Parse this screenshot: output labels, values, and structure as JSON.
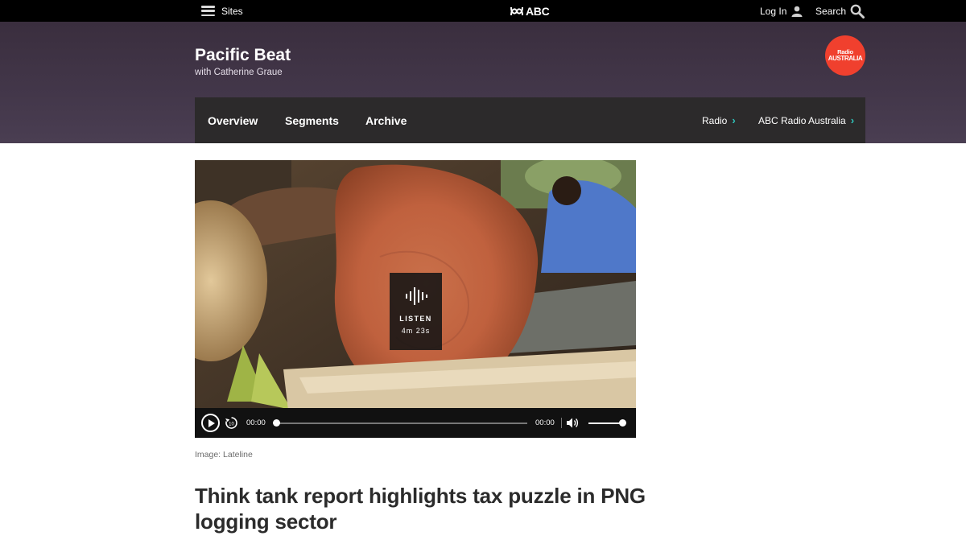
{
  "topbar": {
    "sites_label": "Sites",
    "logo_text": "ABC",
    "login_label": "Log In",
    "search_label": "Search"
  },
  "program": {
    "title": "Pacific Beat",
    "host": "with Catherine Graue",
    "network_logo": {
      "line1": "Radio",
      "line2": "AUSTRALIA",
      "color": "#f0402e"
    }
  },
  "subnav": {
    "tabs": [
      {
        "label": "Overview"
      },
      {
        "label": "Segments"
      },
      {
        "label": "Archive"
      }
    ],
    "crumbs": [
      {
        "label": "Radio"
      },
      {
        "label": "ABC Radio Australia"
      }
    ],
    "accent_color": "#2fc7bd"
  },
  "media": {
    "listen_label": "LISTEN",
    "duration": "4m 23s",
    "player": {
      "current_time": "00:00",
      "total_time": "00:00",
      "progress": 0,
      "volume": 1.0
    },
    "caption": "Image: Lateline"
  },
  "article": {
    "headline": "Think tank report highlights tax puzzle in PNG logging sector"
  }
}
